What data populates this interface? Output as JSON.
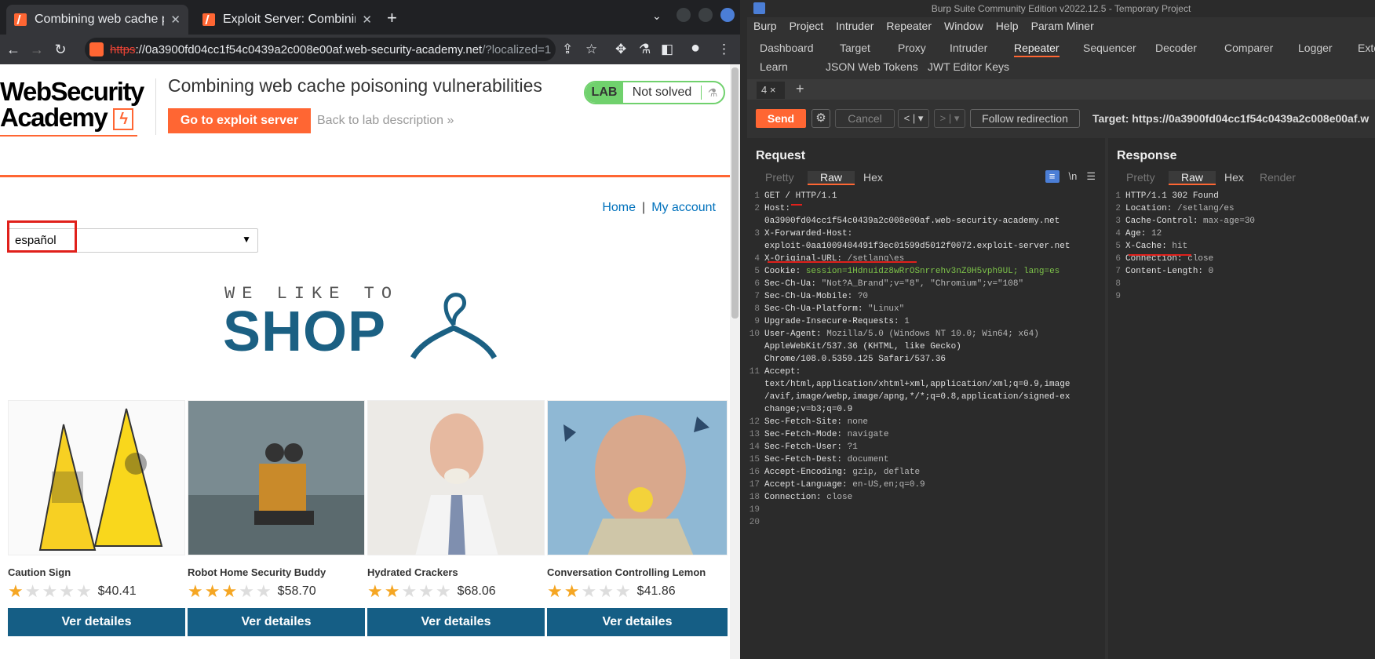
{
  "chrome": {
    "tabs": [
      {
        "title": "Combining web cache poisoning vulnerabilities",
        "close": "✕"
      },
      {
        "title": "Exploit Server: Combining web cache poisoning",
        "close": "✕"
      }
    ],
    "new_tab": "+",
    "url_scheme": "https",
    "url_host": "://0a3900fd04cc1f54c0439a2c008e00af.web-security-academy.net",
    "url_path": "/?localized=1"
  },
  "page": {
    "logo_line1": "WebSecurity",
    "logo_line2": "Academy",
    "lab_title": "Combining web cache poisoning vulnerabilities",
    "exploit_button": "Go to exploit server",
    "back_link": "Back to lab description",
    "back_chevrons": "»",
    "lab_label": "LAB",
    "lab_status": "Not solved",
    "nav_home": "Home",
    "nav_sep": "|",
    "nav_account": "My account",
    "language_value": "español",
    "shop_tagline": "WE LIKE TO",
    "shop_word": "SHOP",
    "products": [
      {
        "name": "Caution Sign",
        "stars": 1,
        "price": "$40.41",
        "button": "Ver detailes"
      },
      {
        "name": "Robot Home Security Buddy",
        "stars": 3,
        "price": "$58.70",
        "button": "Ver detailes"
      },
      {
        "name": "Hydrated Crackers",
        "stars": 2,
        "price": "$68.06",
        "button": "Ver detailes"
      },
      {
        "name": "Conversation Controlling Lemon",
        "stars": 2,
        "price": "$41.86",
        "button": "Ver detailes"
      }
    ]
  },
  "burp": {
    "title": "Burp Suite Community Edition v2022.12.5 - Temporary Project",
    "menu": [
      "Burp",
      "Project",
      "Intruder",
      "Repeater",
      "Window",
      "Help",
      "Param Miner"
    ],
    "tabs_row1": [
      "Dashboard",
      "Target",
      "Proxy",
      "Intruder",
      "Repeater",
      "Sequencer",
      "Decoder",
      "Comparer",
      "Logger",
      "Exte"
    ],
    "tabs_row2": [
      "Learn",
      "JSON Web Tokens",
      "JWT Editor Keys"
    ],
    "active_tab": "Repeater",
    "repeater_tab": "4 ×",
    "send": "Send",
    "cancel": "Cancel",
    "follow": "Follow redirection",
    "target": "Target: https://0a3900fd04cc1f54c0439a2c008e00af.w",
    "request_title": "Request",
    "response_title": "Response",
    "request_views": [
      "Pretty",
      "Raw",
      "Hex"
    ],
    "response_views": [
      "Pretty",
      "Raw",
      "Hex",
      "Render"
    ],
    "request_lines": [
      "GET / HTTP/1.1",
      "Host:",
      "0a3900fd04cc1f54c0439a2c008e00af.web-security-academy.net",
      "X-Forwarded-Host:",
      "exploit-0aa1009404491f3ec01599d5012f0072.exploit-server.net",
      "X-Original-URL: /setlang\\es",
      "Cookie: session=1Hdnuidz8wRrOSnrrehv3nZ0H5vph9UL; lang=es",
      "Sec-Ch-Ua: \"Not?A_Brand\";v=\"8\", \"Chromium\";v=\"108\"",
      "Sec-Ch-Ua-Mobile: ?0",
      "Sec-Ch-Ua-Platform: \"Linux\"",
      "Upgrade-Insecure-Requests: 1",
      "User-Agent: Mozilla/5.0 (Windows NT 10.0; Win64; x64)",
      "AppleWebKit/537.36 (KHTML, like Gecko)",
      "Chrome/108.0.5359.125 Safari/537.36",
      "Accept:",
      "text/html,application/xhtml+xml,application/xml;q=0.9,image",
      "/avif,image/webp,image/apng,*/*;q=0.8,application/signed-ex",
      "change;v=b3;q=0.9",
      "Sec-Fetch-Site: none",
      "Sec-Fetch-Mode: navigate",
      "Sec-Fetch-User: ?1",
      "Sec-Fetch-Dest: document",
      "Accept-Encoding: gzip, deflate",
      "Accept-Language: en-US,en;q=0.9",
      "Connection: close"
    ],
    "request_line_numbers": [
      "1",
      "2",
      "",
      "3",
      "",
      "4",
      "5",
      "6",
      "7",
      "8",
      "9",
      "10",
      "",
      "",
      "11",
      "",
      "",
      "",
      "12",
      "13",
      "14",
      "15",
      "16",
      "17",
      "18",
      "19",
      "20"
    ],
    "response_lines": [
      "HTTP/1.1 302 Found",
      "Location: /setlang/es",
      "Cache-Control: max-age=30",
      "Age: 12",
      "X-Cache: hit",
      "Connection: close",
      "Content-Length: 0"
    ]
  }
}
